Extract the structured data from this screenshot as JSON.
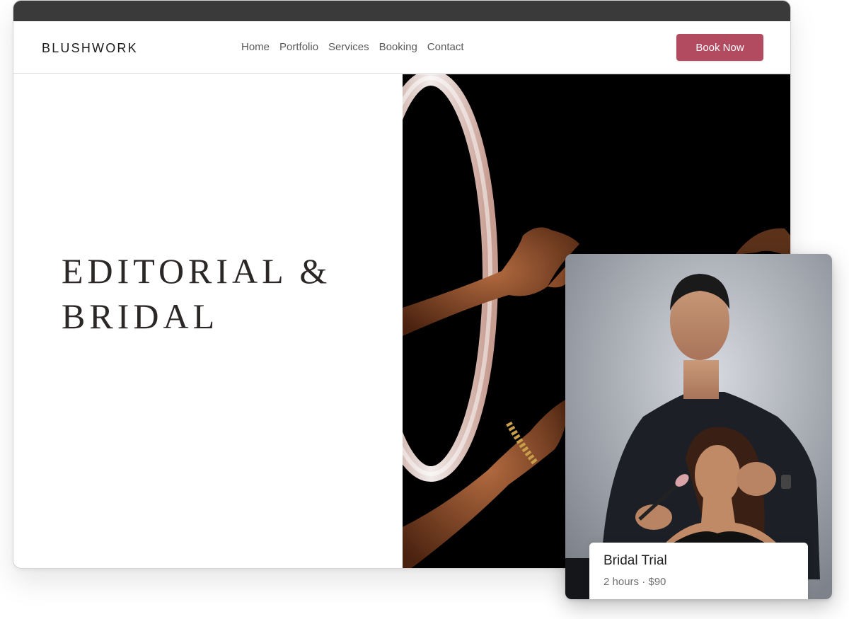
{
  "header": {
    "brand": "BLUSHWORK",
    "nav": [
      "Home",
      "Portfolio",
      "Services",
      "Booking",
      "Contact"
    ],
    "cta_label": "Book Now"
  },
  "hero": {
    "title_line1": "EDITORIAL &",
    "title_line2": "BRIDAL",
    "image_icon": "ring-light-makeup-photo"
  },
  "service_card": {
    "title": "Bridal Trial",
    "meta": "2 hours · $90",
    "image_icon": "artist-and-model-photo"
  },
  "colors": {
    "accent": "#b34b60",
    "titlebar": "#3a3a3a",
    "text_dark": "#2b2726"
  }
}
